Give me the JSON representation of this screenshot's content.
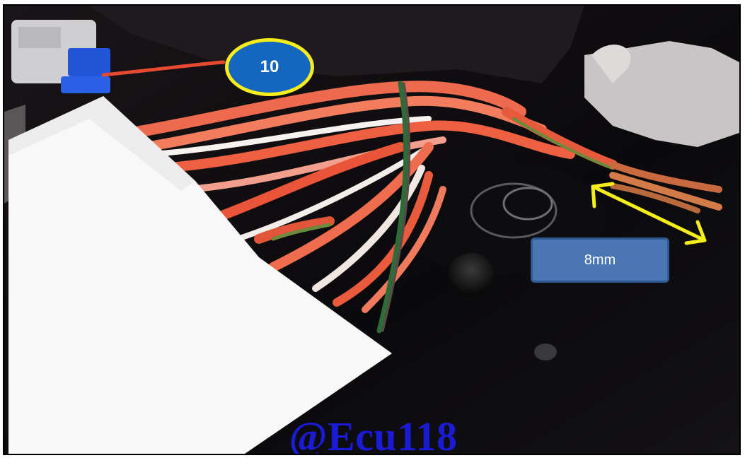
{
  "annotation": {
    "step_number": "10",
    "measurement": "8mm",
    "watermark": "@Ecu118"
  },
  "colors": {
    "badge_fill": "#1466c0",
    "badge_ring": "#f6ee1a",
    "arrow": "#f6ee1a",
    "label_box": "#4a77b4",
    "watermark": "#1b1bd6"
  }
}
